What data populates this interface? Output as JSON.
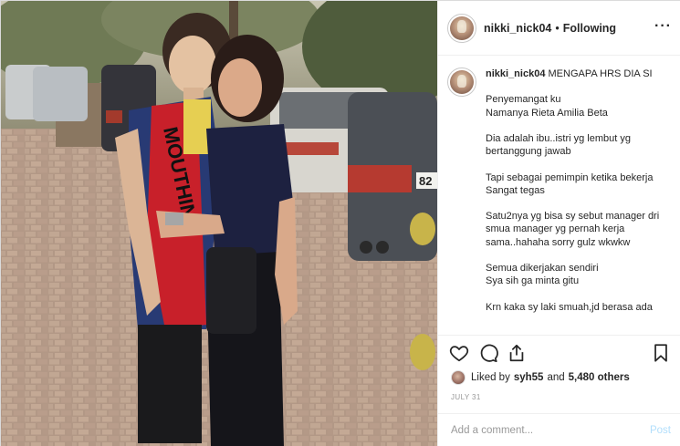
{
  "header": {
    "username": "nikki_nick04",
    "separator": "•",
    "follow_status": "Following",
    "more_icon": "more-options-icon"
  },
  "caption": {
    "username": "nikki_nick04",
    "first_line": "MENGAPA HRS DIA SI",
    "lines": [
      "",
      "Penyemangat ku",
      "Namanya Rieta Amilia Beta",
      "",
      "Dia adalah ibu..istri yg lembut yg",
      "bertanggung jawab",
      "",
      "Tapi sebagai pemimpin ketika bekerja",
      "Sangat tegas",
      "",
      "Satu2nya yg bisa sy sebut manager dri",
      "smua manager yg pernah kerja",
      "sama..hahaha sorry gulz wkwkw",
      "",
      "Semua dikerjakan sendiri",
      "Sya sih ga minta gitu",
      "",
      "Krn kaka sy laki smuah,jd berasa ada"
    ]
  },
  "actions": {
    "like_icon": "heart-icon",
    "comment_icon": "comment-icon",
    "share_icon": "share-icon",
    "save_icon": "bookmark-icon"
  },
  "likes": {
    "prefix": "Liked by",
    "user": "syh55",
    "joiner": "and",
    "others": "5,480 others"
  },
  "date": "JULY 31",
  "comment": {
    "placeholder": "Add a comment...",
    "post_label": "Post"
  },
  "colors": {
    "text": "#262626",
    "muted": "#999999",
    "post_disabled": "#b2dffc",
    "border": "#efefef"
  }
}
